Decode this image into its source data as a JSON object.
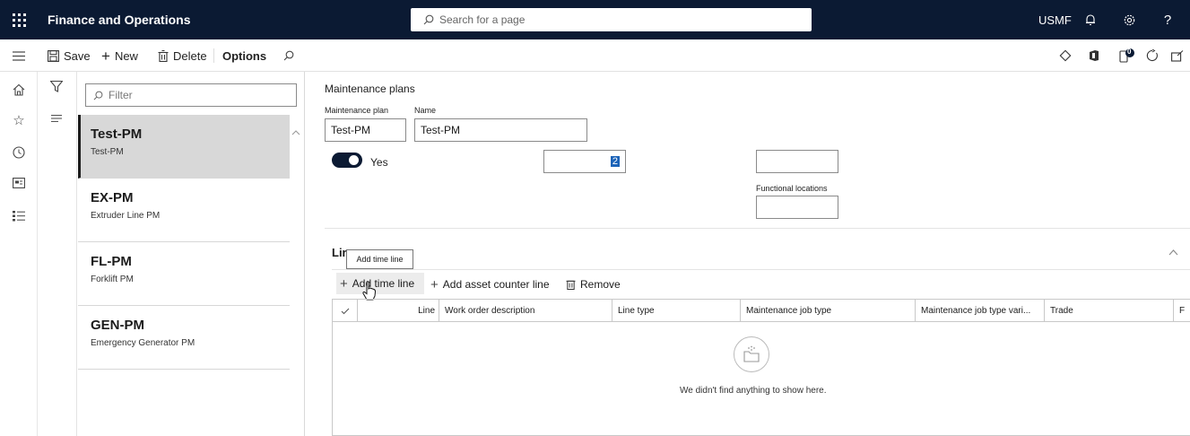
{
  "header": {
    "app_title": "Finance and Operations",
    "search_placeholder": "Search for a page",
    "company": "USMF"
  },
  "actions": {
    "save": "Save",
    "new": "New",
    "delete": "Delete",
    "options": "Options"
  },
  "list": {
    "filter_placeholder": "Filter",
    "items": [
      {
        "title": "Test-PM",
        "sub": "Test-PM"
      },
      {
        "title": "EX-PM",
        "sub": "Extruder Line PM"
      },
      {
        "title": "FL-PM",
        "sub": "Forklift PM"
      },
      {
        "title": "GEN-PM",
        "sub": "Emergency Generator PM"
      }
    ]
  },
  "detail": {
    "breadcrumb": "Maintenance plans",
    "plan_label": "Maintenance plan",
    "plan_value": "Test-PM",
    "name_label": "Name",
    "name_value": "Test-PM",
    "toggle_label": "Yes",
    "number_value": "2",
    "functional_locations_label": "Functional locations"
  },
  "lines": {
    "header": "Lir",
    "tooltip": "Add time line",
    "add_time_line": "Add time line",
    "add_asset_counter_line": "Add asset counter line",
    "remove": "Remove",
    "columns": [
      "Line",
      "Work order description",
      "Line type",
      "Maintenance job type",
      "Maintenance job type vari...",
      "Trade",
      "F"
    ],
    "empty_message": "We didn't find anything to show here."
  },
  "badge_count": "0"
}
